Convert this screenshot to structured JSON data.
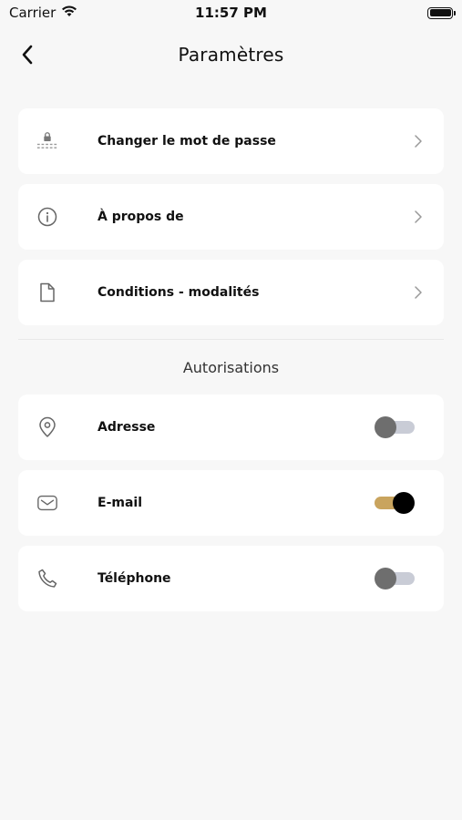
{
  "status_bar": {
    "carrier": "Carrier",
    "time": "11:57 PM"
  },
  "header": {
    "title": "Paramètres"
  },
  "settings": {
    "items": [
      {
        "label": "Changer le mot de passe",
        "icon": "lock-icon"
      },
      {
        "label": "À propos de",
        "icon": "info-icon"
      },
      {
        "label": "Conditions - modalités",
        "icon": "document-icon"
      }
    ]
  },
  "permissions": {
    "title": "Autorisations",
    "items": [
      {
        "label": "Adresse",
        "icon": "location-icon",
        "enabled": false
      },
      {
        "label": "E-mail",
        "icon": "mail-icon",
        "enabled": true
      },
      {
        "label": "Téléphone",
        "icon": "phone-icon",
        "enabled": false
      }
    ]
  },
  "colors": {
    "toggle_on_track": "#c9a45e",
    "toggle_on_knob": "#000000",
    "toggle_off_track": "#c9ccd6",
    "toggle_off_knob": "#6e6e6e",
    "background": "#f7f7f7",
    "card": "#ffffff"
  }
}
